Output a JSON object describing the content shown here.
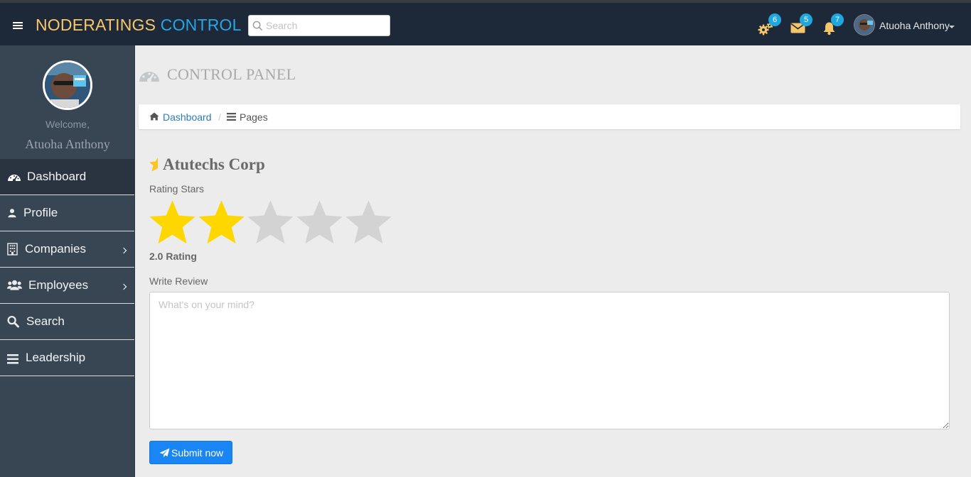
{
  "navbar": {
    "brand_part1": "NODERATINGS",
    "brand_part2": "CONTROL",
    "search_placeholder": "Search",
    "settings_count": "6",
    "messages_count": "5",
    "notifications_count": "7",
    "user_name": "Atuoha Anthony"
  },
  "sidebar": {
    "welcome": "Welcome,",
    "user_name": "Atuoha Anthony",
    "items": [
      {
        "label": "Dashboard",
        "icon": "dashboard-icon",
        "active": true
      },
      {
        "label": "Profile",
        "icon": "user-icon"
      },
      {
        "label": "Companies",
        "icon": "building-icon",
        "has_submenu": true
      },
      {
        "label": "Employees",
        "icon": "users-icon",
        "has_submenu": true
      },
      {
        "label": "Search",
        "icon": "search-icon"
      },
      {
        "label": "Leadership",
        "icon": "bars-icon"
      }
    ]
  },
  "page": {
    "title": "CONTROL PANEL",
    "breadcrumb_home": "Dashboard",
    "breadcrumb_current": "Pages"
  },
  "review": {
    "company": "Atutechs Corp",
    "rating_label": "Rating Stars",
    "rating_value": 2,
    "rating_max": 5,
    "rating_text": "2.0 Rating",
    "write_label": "Write Review",
    "placeholder": "What's on your mind?",
    "submit_label": "Submit now"
  },
  "colors": {
    "star_filled": "#ffd700",
    "star_empty": "#d3d3d3",
    "navbar_bg": "#1d2939",
    "sidebar_bg": "#384553",
    "accent": "#1a86f5"
  }
}
